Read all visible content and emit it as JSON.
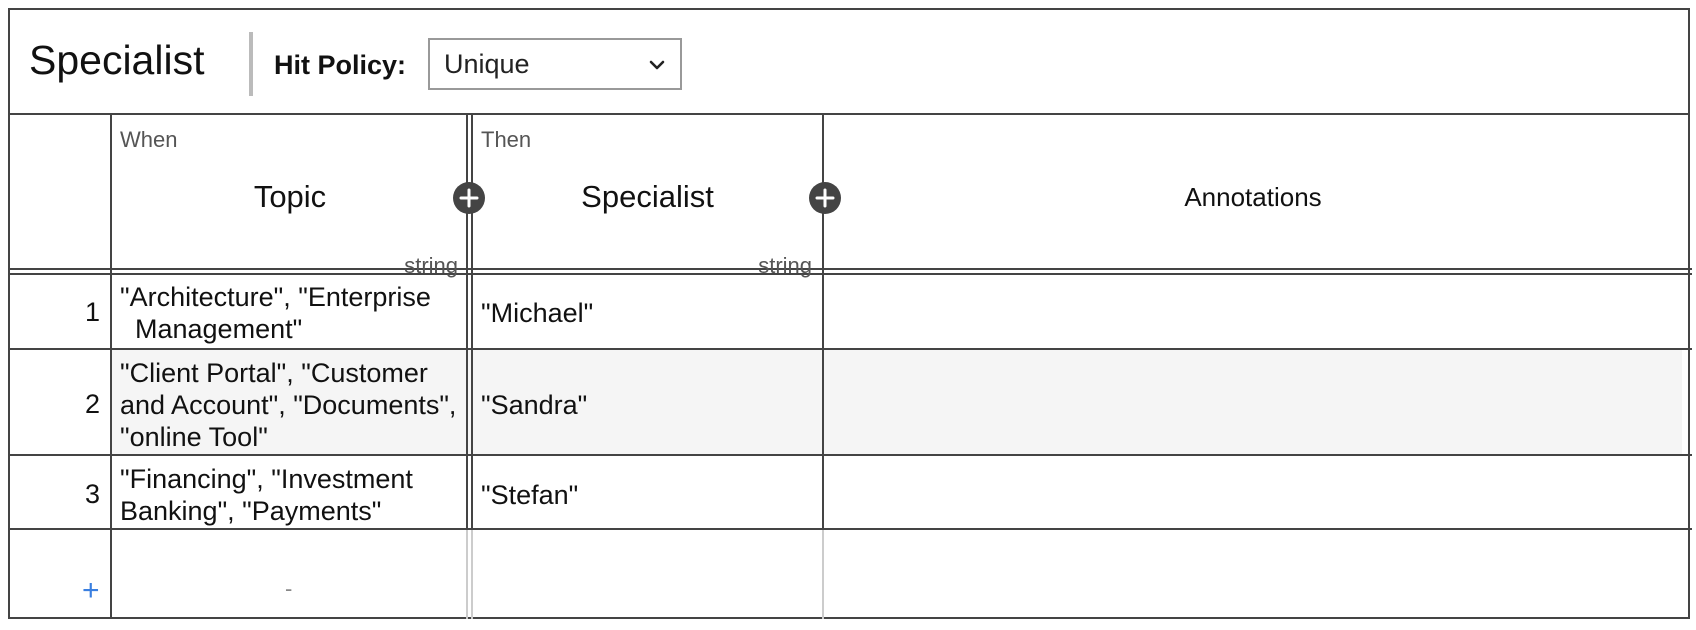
{
  "decision": {
    "title": "Specialist",
    "hit_policy_label": "Hit Policy:",
    "hit_policy_value": "Unique"
  },
  "columns": {
    "input": {
      "kind": "When",
      "name": "Topic",
      "type": "string"
    },
    "output": {
      "kind": "Then",
      "name": "Specialist",
      "type": "string"
    },
    "annotations": {
      "name": "Annotations"
    }
  },
  "rules": [
    {
      "num": "1",
      "topic_line1": "\"Architecture\", \"Enterprise",
      "topic_line2": "  Management\"",
      "topic_line3": "",
      "specialist": "\"Michael\""
    },
    {
      "num": "2",
      "topic_line1": "\"Client Portal\", \"Customer",
      "topic_line2": "and Account\", \"Documents\",",
      "topic_line3": "\"online Tool\"",
      "specialist": "\"Sandra\""
    },
    {
      "num": "3",
      "topic_line1": "\"Financing\", \"Investment",
      "topic_line2": "Banking\", \"Payments\"",
      "topic_line3": "",
      "specialist": "\"Stefan\""
    }
  ],
  "new_row": {
    "add_symbol": "+",
    "placeholder": "-"
  },
  "icons": {
    "add_column": "plus-circle-icon",
    "dropdown": "chevron-down-icon"
  },
  "colors": {
    "border": "#444444",
    "accent": "#3a7fe0",
    "alt_row": "#f5f5f5"
  }
}
